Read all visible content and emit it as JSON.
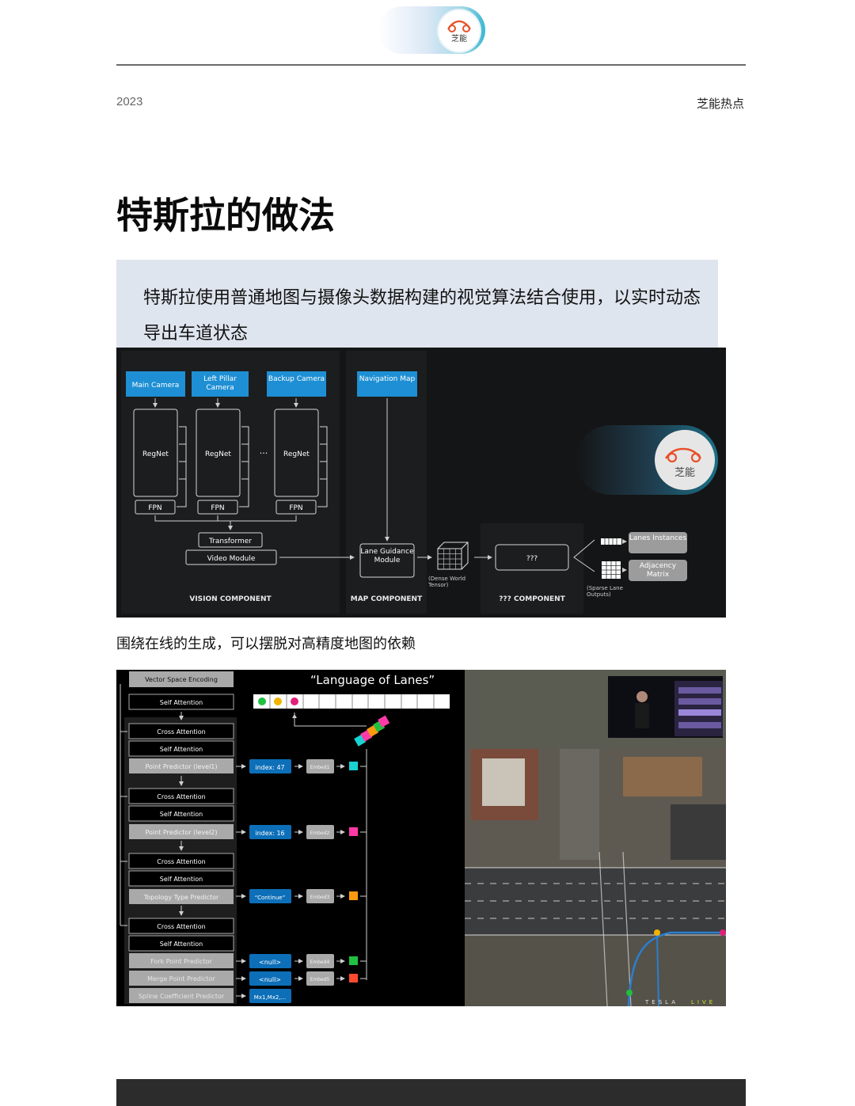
{
  "header": {
    "logo_text": "芝能",
    "year": "2023",
    "brand": "芝能热点"
  },
  "article": {
    "title": "特斯拉的做法",
    "quote": "特斯拉使用普通地图与摄像头数据构建的视觉算法结合使用，以实时动态导出车道状态",
    "caption": "围绕在线的生成，可以摆脱对高精度地图的依赖"
  },
  "figure1": {
    "cameras": [
      "Main Camera",
      "Left Pillar Camera",
      "Backup Camera"
    ],
    "backbone": "RegNet",
    "neck": "FPN",
    "ellipsis": "···",
    "transformer": "Transformer",
    "video_module": "Video Module",
    "navigation_map": "Navigation Map",
    "lane_guidance": "Lane Guidance Module",
    "dense_tensor": "(Dense World Tensor)",
    "unknown": "???",
    "sparse_outputs": "(Sparse Lane Outputs)",
    "lanes_instances": "Lanes Instances",
    "adjacency_matrix": "Adjacency Matrix",
    "watermark": "芝能",
    "sections": [
      "VISION COMPONENT",
      "MAP COMPONENT",
      "??? COMPONENT"
    ]
  },
  "figure2": {
    "encoding": "Vector Space Encoding",
    "first_self_attention": "Self Attention",
    "heading": "“Language of Lanes”",
    "cross_attention": "Cross Attention",
    "self_attention": "Self Attention",
    "predictors": [
      "Point Predictor (level1)",
      "Point Predictor (level2)",
      "Topology Type Predictor",
      "Fork Point Predictor",
      "Merge Point Predictor",
      "Spline Coefficient Predictor"
    ],
    "outputs": [
      "index: 47",
      "index: 16",
      "“Continue”",
      "<null>",
      "<null>",
      "Mx1,Mx2,..."
    ],
    "embeds": [
      "Embed1",
      "Embed2",
      "Embed3",
      "Embed4",
      "Embed5"
    ],
    "tesla_mark": "TESLA",
    "live_mark": "LIVE"
  },
  "colors": {
    "accent_blue": "#1e8fd4",
    "panel_dark": "#1c1d1e",
    "quote_bg": "#dfe5ee",
    "lane_green": "#20c040",
    "lane_yellow": "#f2b400",
    "lane_magenta": "#e0207a",
    "cube_teal": "#19d2d2",
    "cube_pink": "#ff3aa8",
    "cube_orange": "#ff9a10",
    "cube_red": "#ff4a30"
  }
}
